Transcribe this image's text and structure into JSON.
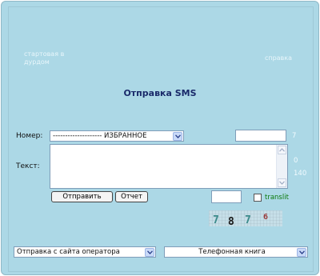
{
  "top_links": {
    "start": "стартовая в дурдом",
    "help": "справка"
  },
  "title": "Отправка SMS",
  "form": {
    "number_label": "Номер:",
    "number_select_value": "-------------------- ИЗБРАННОЕ",
    "number_char_count": "7",
    "text_label": "Текст:",
    "text_value": "",
    "text_count_used": "0",
    "text_count_limit": "140",
    "send_button": "Отправить",
    "report_button": "Отчет",
    "translit_label": "translit",
    "translit_checked": false,
    "captcha_digits": [
      "7",
      "8",
      "7",
      "6"
    ]
  },
  "bottom": {
    "operator_select": "Отправка с сайта оператора",
    "phonebook_select": "Телефонная книга"
  },
  "colors": {
    "background": "#acd8e6",
    "title": "#1a2a6a",
    "translit": "#0b7a0b",
    "captcha_digits": "#3a8a8a"
  }
}
